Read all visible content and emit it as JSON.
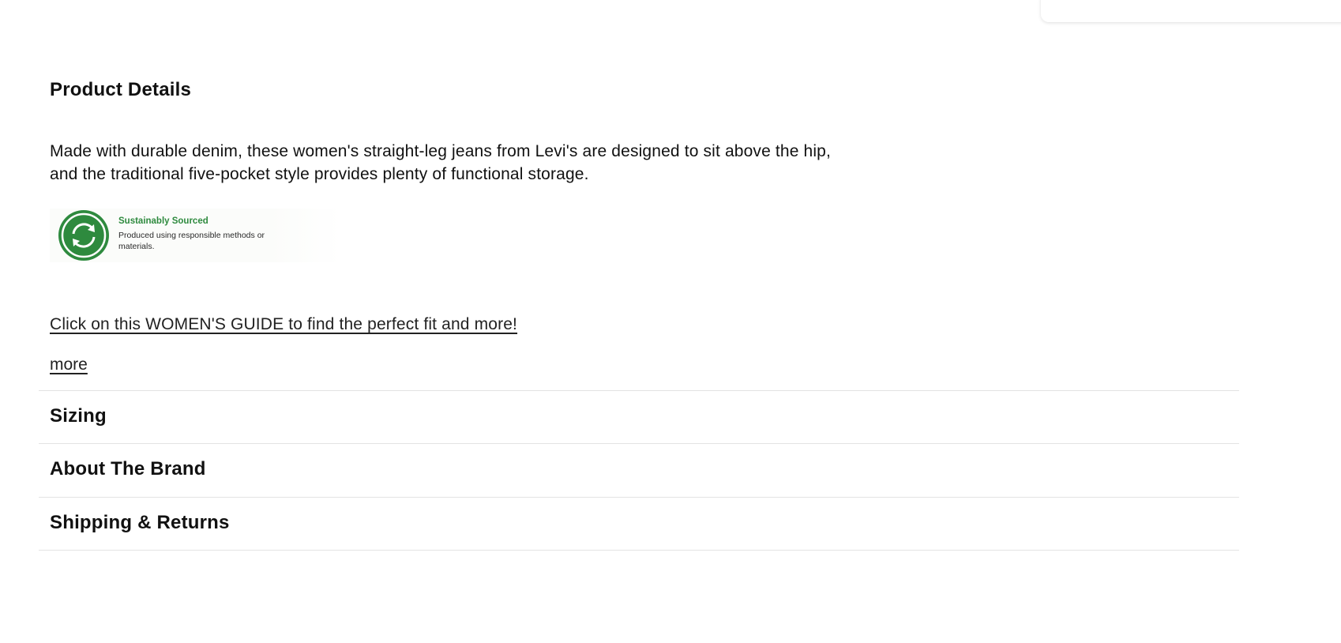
{
  "product_details": {
    "title": "Product Details",
    "description": "Made with durable denim, these women's straight-leg jeans from Levi's are designed to sit above the hip, and the traditional five-pocket style provides plenty of functional storage.",
    "badge": {
      "title": "Sustainably Sourced",
      "text": "Produced using responsible methods or materials.",
      "icon": "recycle-arrows-icon",
      "color": "#2e8a3e"
    },
    "guide_link": "Click on this WOMEN'S GUIDE to find the perfect fit and more!",
    "more_link": "more"
  },
  "accordion": [
    {
      "label": "Sizing"
    },
    {
      "label": "About The Brand"
    },
    {
      "label": "Shipping & Returns"
    }
  ]
}
